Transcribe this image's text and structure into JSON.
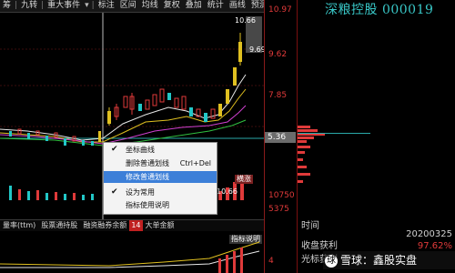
{
  "toolbar": {
    "items": [
      "筹",
      "九转",
      "重大事件",
      "标注",
      "区间",
      "均线",
      "复权",
      "叠加",
      "统计",
      "画线",
      "预测"
    ],
    "overflow_icon": "chevron-down-icon"
  },
  "price_axis": {
    "labels": [
      "10.97",
      "9.62",
      "7.85",
      "5.36",
      "10750",
      "5375",
      "4"
    ],
    "current_price": "5.36"
  },
  "chart_annotations": {
    "high_label": "10.66",
    "high_label_2": "9.69",
    "badge": "横涨",
    "vol_high": "10.66",
    "indicator_tip": "指标说明"
  },
  "stock_panel": {
    "title": "深粮控股 000019",
    "rows": [
      {
        "label": "时间",
        "value": ""
      },
      {
        "label": "",
        "value": "20200325"
      },
      {
        "label": "收盘获利",
        "value": "97.62%"
      },
      {
        "label": "光标获利",
        "value": ""
      }
    ]
  },
  "context_menu": {
    "items": [
      {
        "label": "坐标曲线",
        "checked": true,
        "shortcut": "",
        "state": "normal"
      },
      {
        "label": "删除普通划线",
        "checked": false,
        "shortcut": "Ctrl+Del",
        "state": "normal"
      },
      {
        "label": "修改普通划线",
        "checked": false,
        "shortcut": "",
        "state": "highlight"
      },
      {
        "label": "设为常用",
        "checked": true,
        "shortcut": "",
        "state": "normal"
      },
      {
        "label": "指标使用说明",
        "checked": false,
        "shortcut": "",
        "state": "normal"
      }
    ]
  },
  "tabs": {
    "items": [
      "量率(ttm)",
      "股票通持股",
      "融资融券余额"
    ],
    "num_badge": "14",
    "extra": "大单金额"
  },
  "watermark": {
    "logo": "球",
    "text": "雪球：鑫股实盘"
  },
  "colors": {
    "up": "#e03a3a",
    "down": "#22c7c7",
    "accent_cyan": "#39c7c7",
    "highlight": "#3c7fd8",
    "axis_border": "#8a1a1a"
  }
}
